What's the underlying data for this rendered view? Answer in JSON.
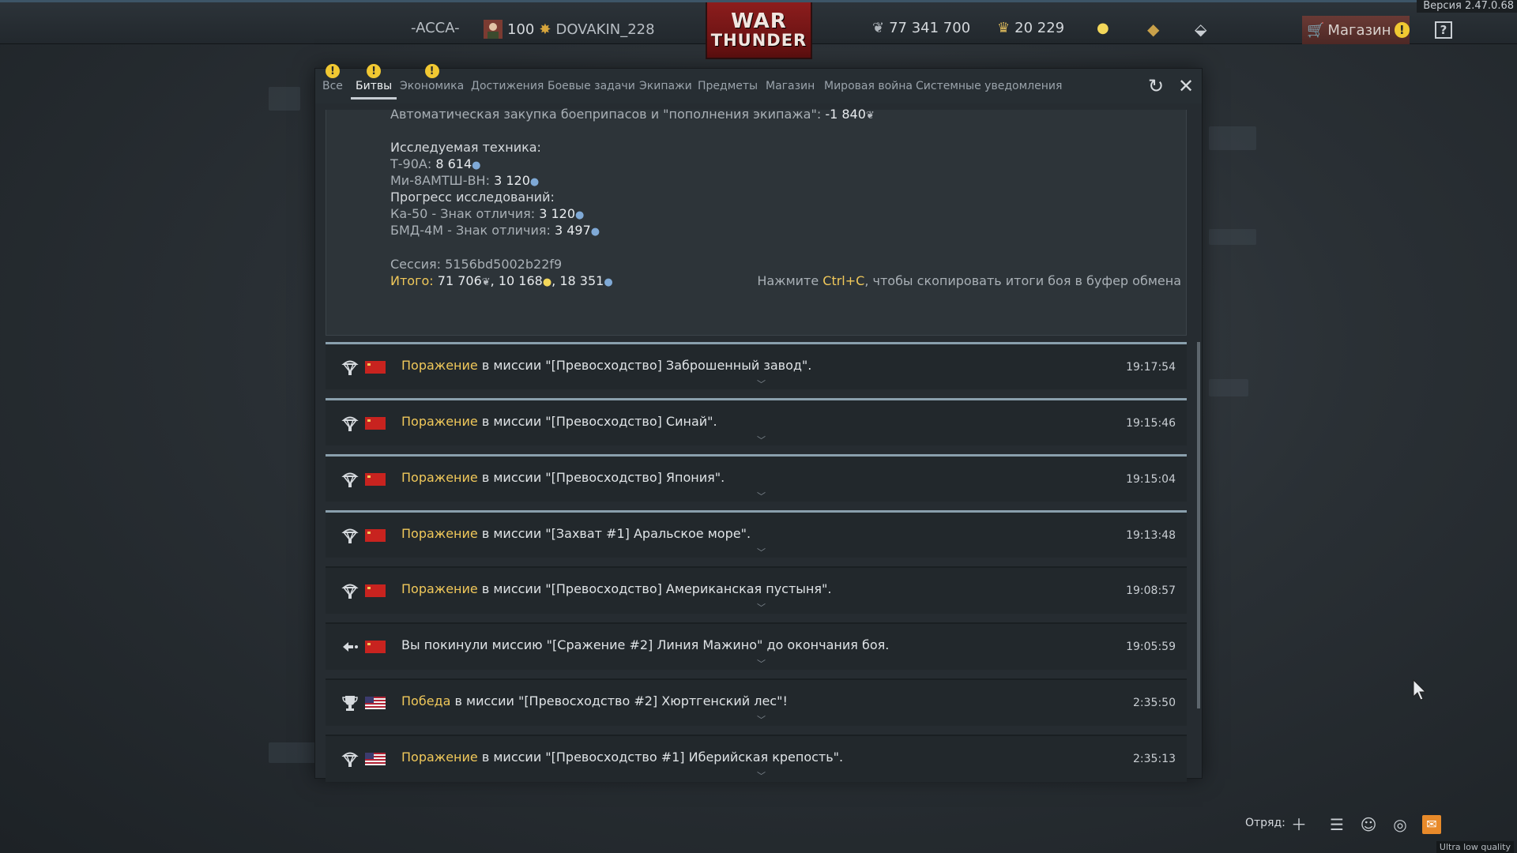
{
  "version": "Версия 2.47.0.68",
  "topbar": {
    "squadron_tag": "-ACCA-",
    "level": "100",
    "username": "DOVAKIN_228",
    "logo_line1": "WAR",
    "logo_line2": "THUNDER",
    "silver_lions": "77 341 700",
    "golden_eagles": "20 229",
    "shop_label": "Магазин",
    "help_label": "?"
  },
  "tabs": [
    {
      "label": "Все",
      "warning": true
    },
    {
      "label": "Битвы",
      "warning": true,
      "active": true
    },
    {
      "label": "Экономика",
      "warning": true
    },
    {
      "label": "Достижения",
      "warning": false
    },
    {
      "label": "Боевые задачи",
      "warning": false
    },
    {
      "label": "Экипажи",
      "warning": false
    },
    {
      "label": "Предметы",
      "warning": false
    },
    {
      "label": "Магазин",
      "warning": false
    },
    {
      "label": "Мировая война",
      "warning": false
    },
    {
      "label": "Системные уведомления",
      "warning": false
    }
  ],
  "warning_mark": "!",
  "detail": {
    "autobuy_text": "Автоматическая закупка боеприпасов и \"пополнения экипажа\":",
    "autobuy_value": "-1 840",
    "research_header": "Исследуемая техника:",
    "veh1_name": "Т-90А:",
    "veh1_value": "8 614",
    "veh2_name": "Ми-8АМТШ-ВН:",
    "veh2_value": "3 120",
    "progress_header": "Прогресс исследований:",
    "prog1_name": "Ка-50 - Знак отличия:",
    "prog1_value": "3 120",
    "prog2_name": "БМД-4М - Знак отличия:",
    "prog2_value": "3 497",
    "session": "Сессия: 5156bd5002b22f9",
    "total_label": "Итого:",
    "total_silver": "71 706",
    "total_rp_gold": "10 168",
    "total_rp": "18 351",
    "hint_pre": "Нажмите ",
    "hint_key": "Ctrl+C",
    "hint_post": ", чтобы скопировать итоги боя в буфер обмена"
  },
  "rows": [
    {
      "result": "Поражение",
      "text": " в миссии \"[Превосходство] Заброшенный завод\".",
      "time": "19:17:54",
      "flag": "ussr",
      "icon": "defeat",
      "highlight": true
    },
    {
      "result": "Поражение",
      "text": " в миссии \"[Превосходство] Синай\".",
      "time": "19:15:46",
      "flag": "ussr",
      "icon": "defeat",
      "highlight": true
    },
    {
      "result": "Поражение",
      "text": " в миссии \"[Превосходство] Япония\".",
      "time": "19:15:04",
      "flag": "ussr",
      "icon": "defeat",
      "highlight": true
    },
    {
      "result": "Поражение",
      "text": " в миссии \"[Захват #1] Аральское море\".",
      "time": "19:13:48",
      "flag": "ussr",
      "icon": "defeat",
      "highlight": true
    },
    {
      "result": "Поражение",
      "text": " в миссии \"[Превосходство] Американская пустыня\".",
      "time": "19:08:57",
      "flag": "ussr",
      "icon": "defeat",
      "highlight": false
    },
    {
      "result": "",
      "text": "Вы покинули миссию \"[Сражение #2] Линия Мажино\" до окончания боя.",
      "time": "19:05:59",
      "flag": "ussr",
      "icon": "left",
      "highlight": false
    },
    {
      "result": "Победа",
      "text": " в миссии \"[Превосходство #2] Хюртгенский лес\"!",
      "time": "2:35:50",
      "flag": "usa",
      "icon": "victory",
      "highlight": false
    },
    {
      "result": "Поражение",
      "text": " в миссии \"[Превосходство #1] Иберийская крепость\".",
      "time": "2:35:13",
      "flag": "usa",
      "icon": "defeat",
      "highlight": false
    }
  ],
  "bottombar": {
    "squad_label": "Отряд:",
    "quality": "Ultra low quality"
  },
  "colors": {
    "accent_yellow": "#f0c85a",
    "rp_blue": "#7fa9d6",
    "row_highlight_border": "#8aa0ad",
    "mail_orange": "#e88a2a"
  }
}
